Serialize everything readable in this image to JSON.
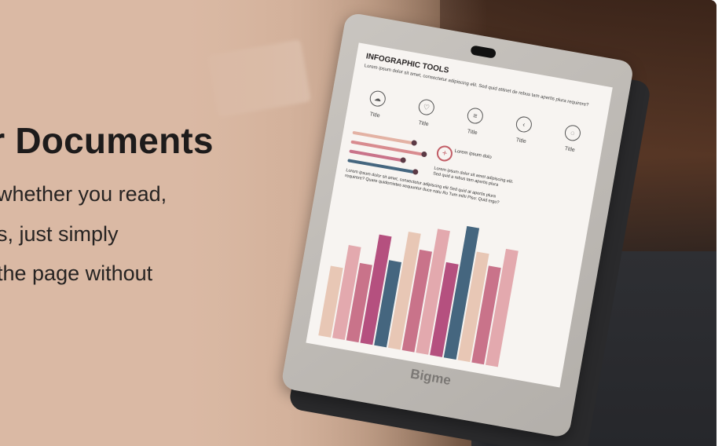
{
  "banner": {
    "headline": "ur Documents",
    "lines": [
      "whether you read,",
      "s, just simply",
      "the page without"
    ]
  },
  "device": {
    "brand": "Bigme",
    "screen": {
      "title": "INFOGRAPHIC TOOLS",
      "subtitle": "Lorem ipsum dolor sit amet, consectetur adipiscing elit. Sed quid attinet de rebus tam apertis plura requirere?",
      "icon_label": "Title",
      "plus_text": "Lorem ipsum dolo",
      "side_text": "Lorem ipsum dolor sit amet adipiscing elit. Sed quid a rebus tam apertis plura",
      "paragraph": "Lorem ipsum dolor sit amet, consectetur adipiscing elit Sed quid at apertis plura requirere? Quare quidemistes sequuntur duce natu Ro Tum mihi Piso: Quid ergo?"
    }
  },
  "colors": {
    "bar_pink": "#e3a9ae",
    "bar_rose": "#c9738a",
    "bar_magenta": "#b5507f",
    "bar_slate": "#45667f",
    "bar_peach": "#e8c7b5"
  }
}
